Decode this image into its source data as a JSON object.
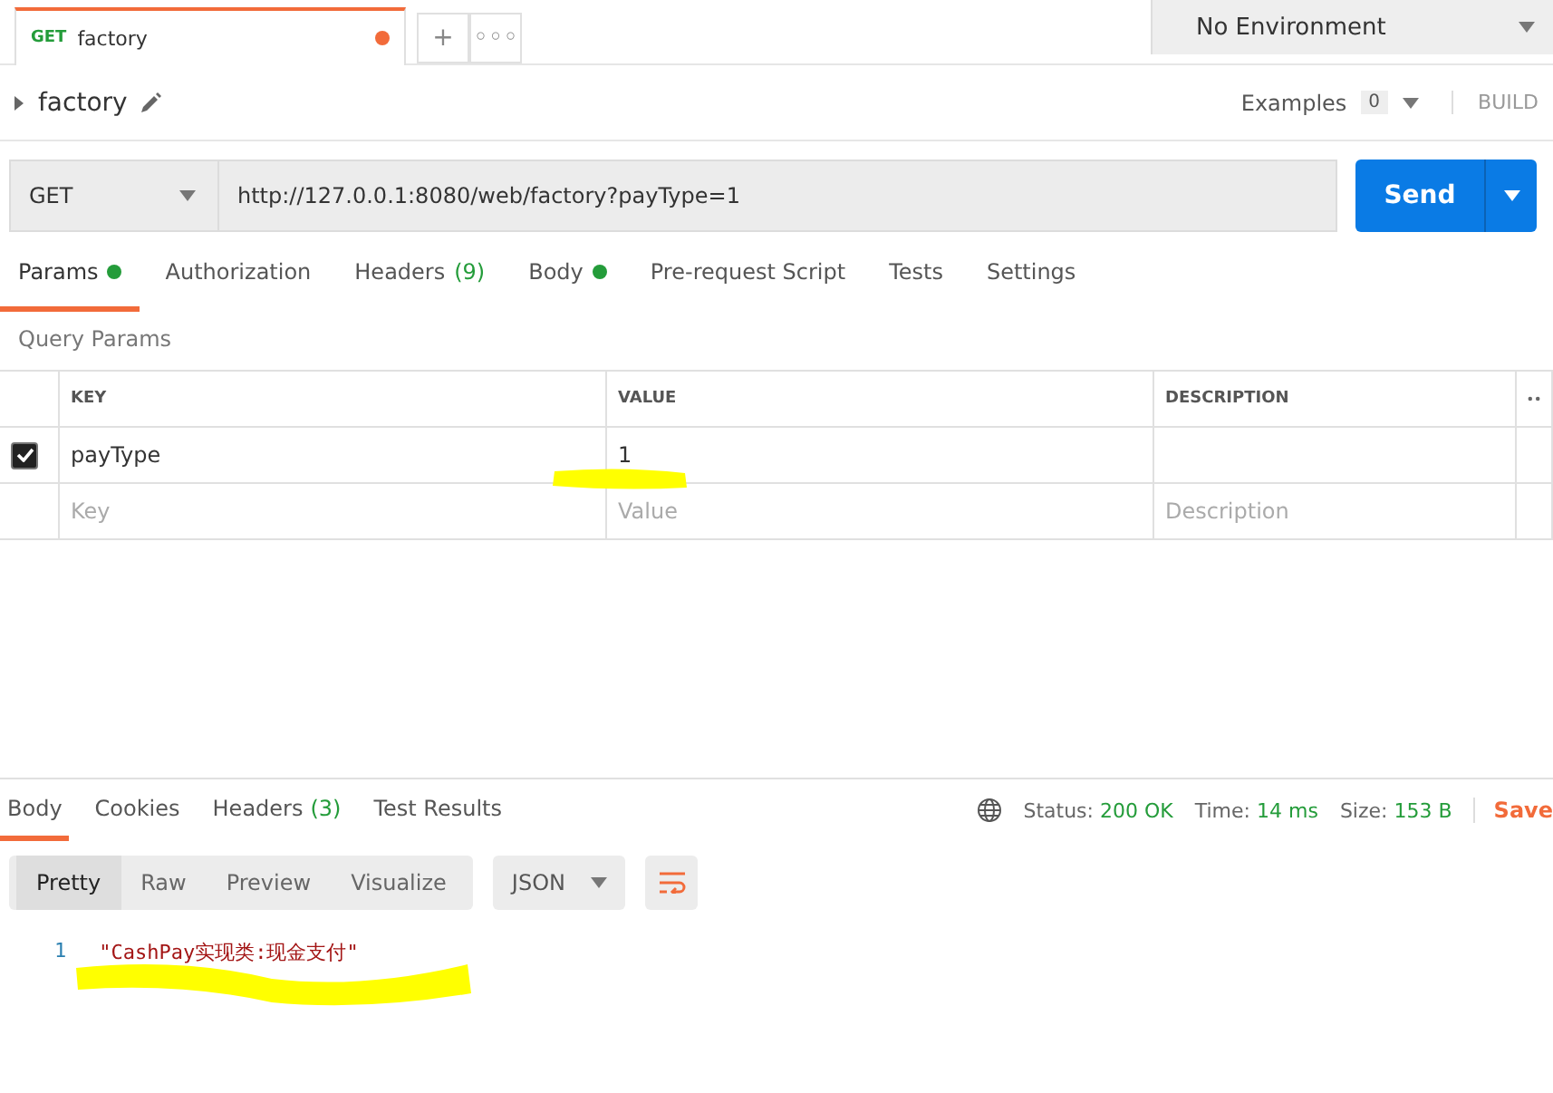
{
  "request_tabs": [
    {
      "method": "GET",
      "name": "factory",
      "unsaved": true,
      "selected": true
    }
  ],
  "tab_actions": [
    "+",
    "◦◦◦"
  ],
  "environment": {
    "value": "No Environment"
  },
  "request": {
    "name": "factory",
    "examples_label": "Examples",
    "examples_count": "0",
    "build": "BUILD",
    "method": "GET",
    "url": "http://127.0.0.1:8080/web/factory?payType=1",
    "send": "Send"
  },
  "request_sections": [
    {
      "label": "Params",
      "dot": true,
      "selected": true
    },
    {
      "label": "Authorization",
      "dot": false,
      "selected": false
    },
    {
      "label": "Headers",
      "count": "(9)",
      "dot": false,
      "selected": false
    },
    {
      "label": "Body",
      "dot": true,
      "selected": false
    },
    {
      "label": "Pre-request Script",
      "dot": false,
      "selected": false
    },
    {
      "label": "Tests",
      "dot": false,
      "selected": false
    },
    {
      "label": "Settings",
      "dot": false,
      "selected": false
    }
  ],
  "query_params": {
    "title": "Query Params",
    "columns": [
      "KEY",
      "VALUE",
      "DESCRIPTION"
    ],
    "rows": [
      {
        "checked": true,
        "key": "payType",
        "value": "1"
      }
    ],
    "new_row": {
      "key_placeholder": "Key",
      "value_placeholder": "Value",
      "description_placeholder": "Description"
    }
  },
  "response_tabs": [
    {
      "label": "Body",
      "selected": true
    },
    {
      "label": "Cookies",
      "selected": false
    },
    {
      "label": "Headers",
      "count": "(3)",
      "selected": false
    },
    {
      "label": "Test Results",
      "selected": false
    }
  ],
  "status": [
    {
      "label": "Status:",
      "value": "200 OK"
    },
    {
      "label": "Time:",
      "value": "14 ms"
    },
    {
      "label": "Size:",
      "value": "153 B"
    }
  ],
  "save": "Save",
  "views": [
    {
      "label": "Pretty",
      "selected": true
    },
    {
      "label": "Raw",
      "selected": false
    },
    {
      "label": "Preview",
      "selected": false
    },
    {
      "label": "Visualize",
      "selected": false
    }
  ],
  "format": "JSON",
  "code_lines": [
    {
      "number": "1",
      "text": "\"CashPay实现类:现金支付\""
    }
  ]
}
